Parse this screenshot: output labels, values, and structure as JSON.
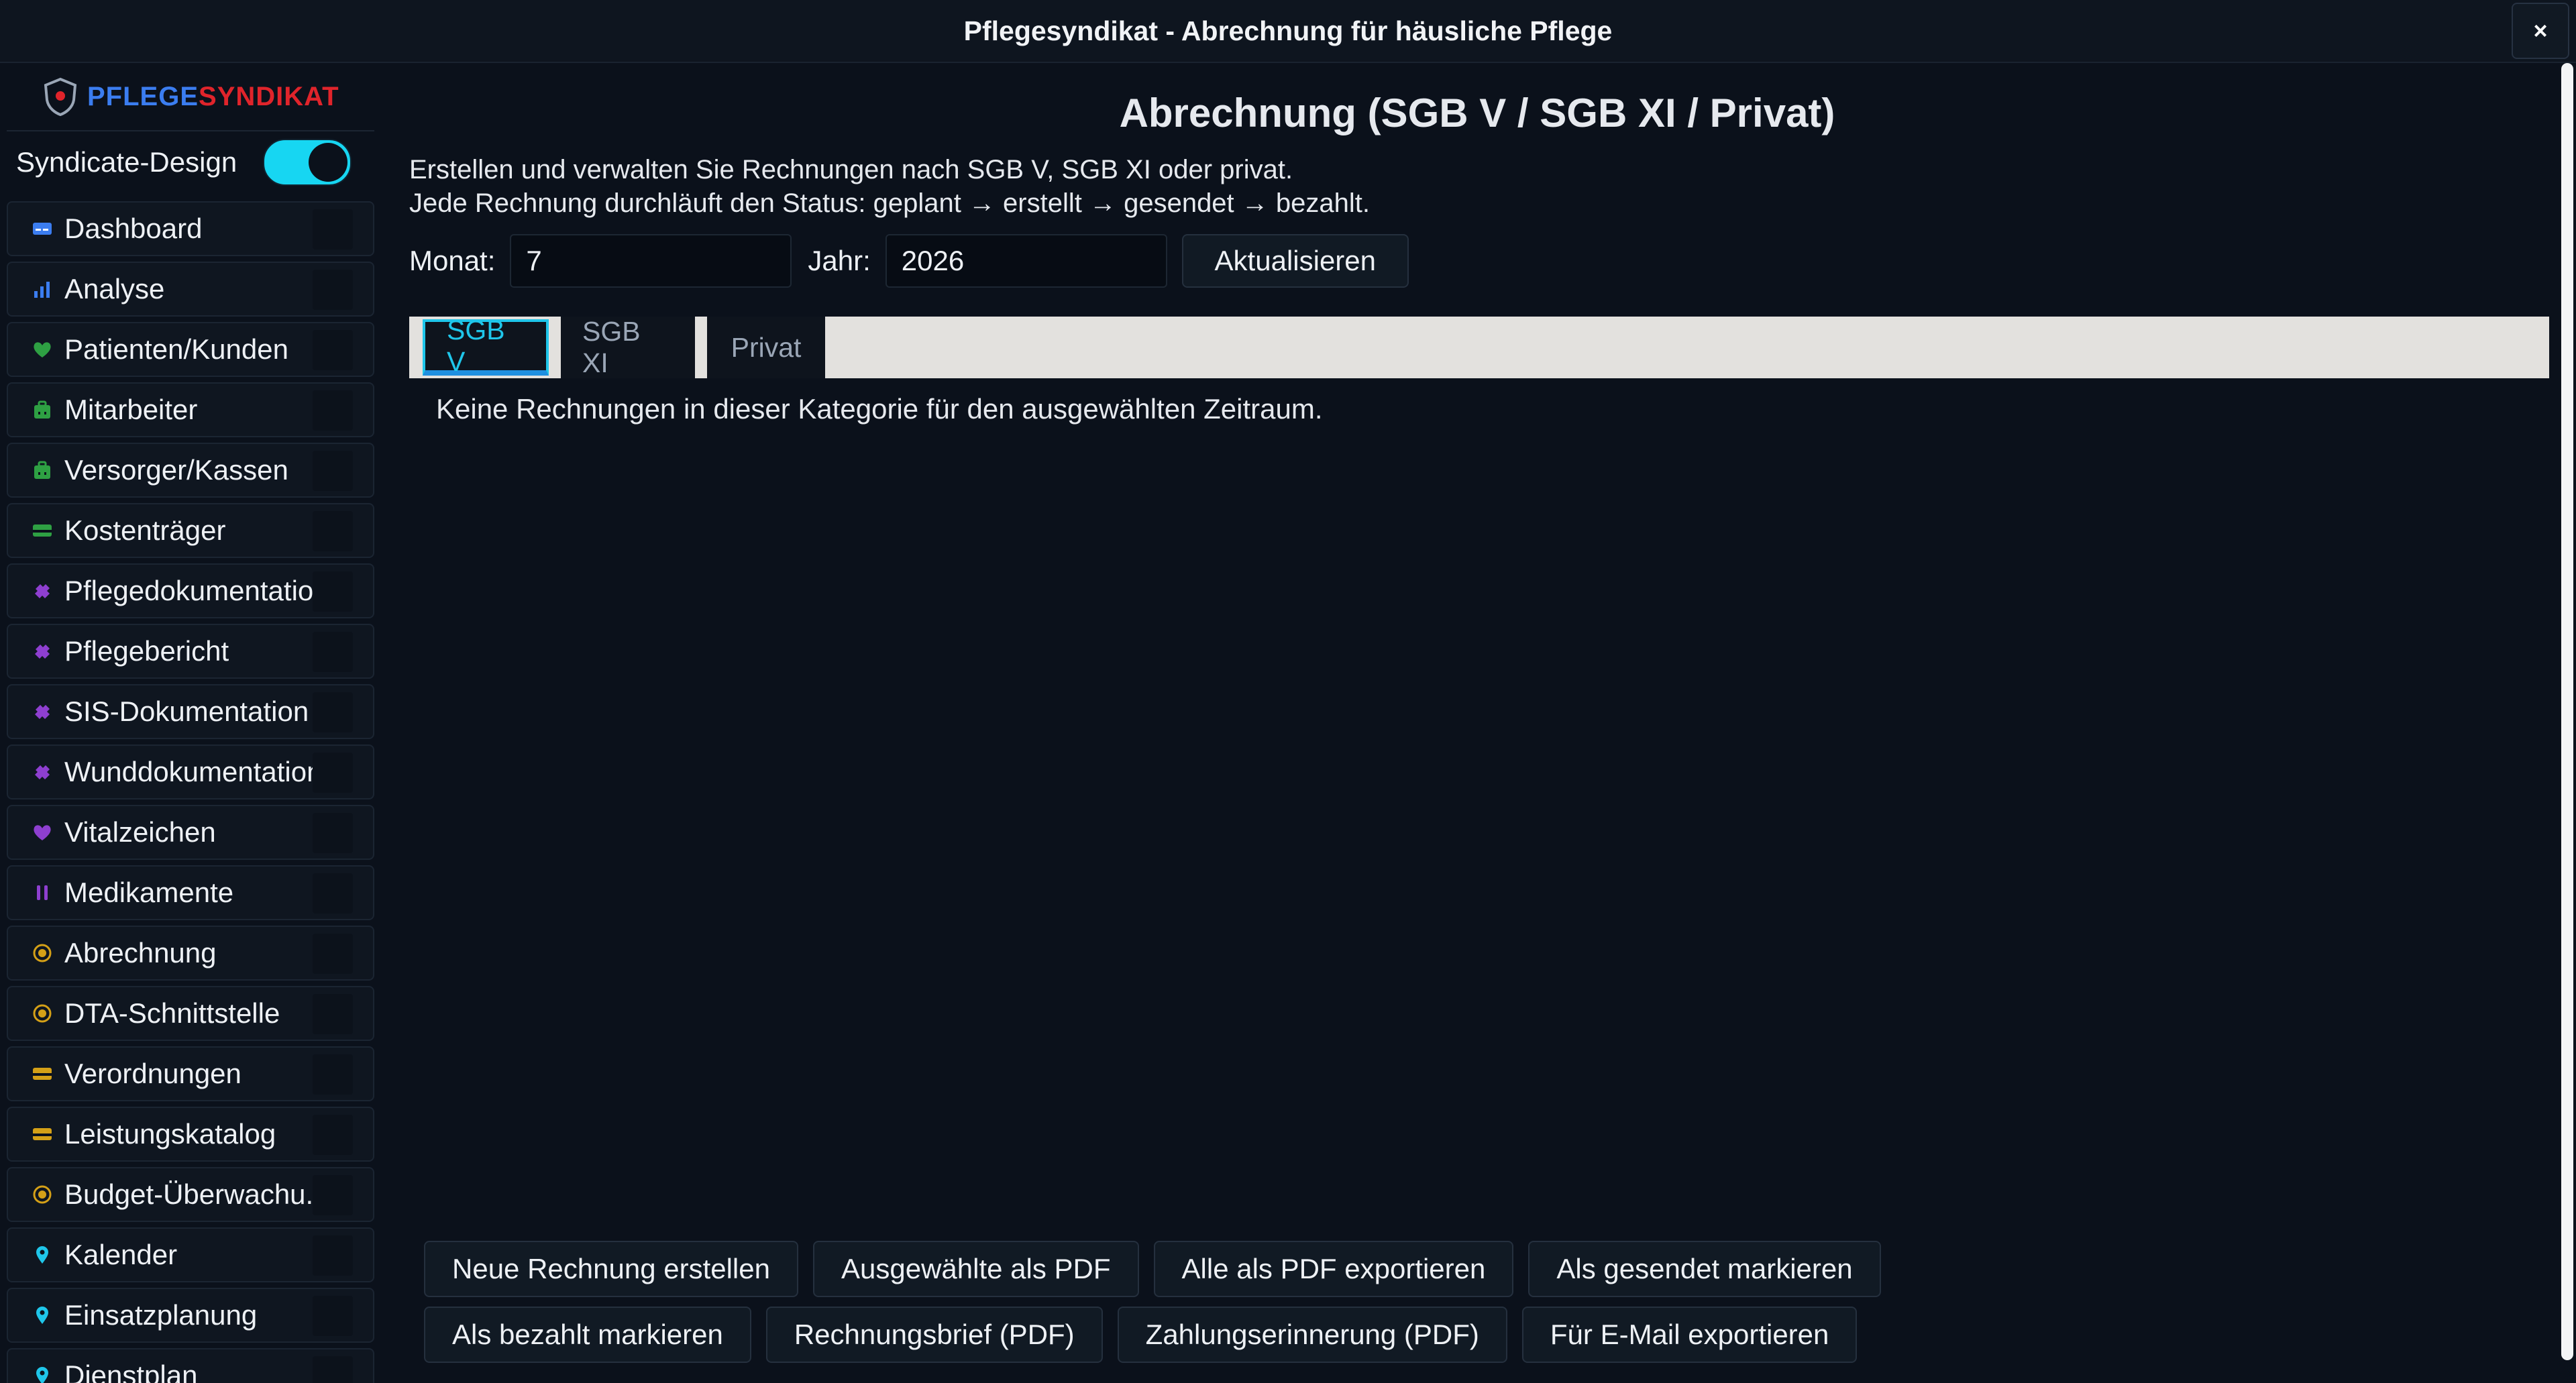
{
  "window": {
    "title": "Pflegesyndikat - Abrechnung für häusliche Pflege",
    "close_label": "×"
  },
  "sidebar": {
    "logo_part1": "PFLEGE",
    "logo_part2": "SYNDIKAT",
    "design_toggle_label": "Syndicate-Design",
    "design_toggle_on": true,
    "items": [
      {
        "label": "Dashboard",
        "icon": "dashboard-card-icon",
        "color": "#3b7df0"
      },
      {
        "label": "Analyse",
        "icon": "bar-chart-icon",
        "color": "#3b7df0"
      },
      {
        "label": "Patienten/Kunden",
        "icon": "heart-icon",
        "color": "#2ea043"
      },
      {
        "label": "Mitarbeiter",
        "icon": "briefcase-icon",
        "color": "#2ea043"
      },
      {
        "label": "Versorger/Kassen",
        "icon": "briefcase-icon",
        "color": "#2ea043"
      },
      {
        "label": "Kostenträger",
        "icon": "card-icon",
        "color": "#2ea043"
      },
      {
        "label": "Pflegedokumentation",
        "icon": "puzzle-icon",
        "color": "#8e3fd0"
      },
      {
        "label": "Pflegebericht",
        "icon": "puzzle-icon",
        "color": "#8e3fd0"
      },
      {
        "label": "SIS-Dokumentation",
        "icon": "puzzle-icon",
        "color": "#8e3fd0"
      },
      {
        "label": "Wunddokumentation",
        "icon": "puzzle-icon",
        "color": "#8e3fd0"
      },
      {
        "label": "Vitalzeichen",
        "icon": "heart-icon",
        "color": "#8e3fd0"
      },
      {
        "label": "Medikamente",
        "icon": "pause-icon",
        "color": "#8e3fd0"
      },
      {
        "label": "Abrechnung",
        "icon": "coin-icon",
        "color": "#d4a017"
      },
      {
        "label": "DTA-Schnittstelle",
        "icon": "coin-icon",
        "color": "#d4a017"
      },
      {
        "label": "Verordnungen",
        "icon": "card-icon",
        "color": "#d4a017"
      },
      {
        "label": "Leistungskatalog",
        "icon": "card-icon",
        "color": "#d4a017"
      },
      {
        "label": "Budget-Überwachu...",
        "icon": "coin-icon",
        "color": "#d4a017"
      },
      {
        "label": "Kalender",
        "icon": "pin-icon",
        "color": "#1fc6ea"
      },
      {
        "label": "Einsatzplanung",
        "icon": "pin-icon",
        "color": "#1fc6ea"
      },
      {
        "label": "Dienstplan",
        "icon": "pin-icon",
        "color": "#1fc6ea"
      }
    ]
  },
  "main": {
    "title": "Abrechnung (SGB V / SGB XI / Privat)",
    "intro_line1": "Erstellen und verwalten Sie Rechnungen nach SGB V, SGB XI oder privat.",
    "intro_line2": "Jede Rechnung durchläuft den Status: geplant → erstellt → gesendet → bezahlt.",
    "month_label": "Monat:",
    "month_value": "7",
    "year_label": "Jahr:",
    "year_value": "2026",
    "refresh_label": "Aktualisieren",
    "tabs": [
      {
        "label": "SGB V",
        "active": true
      },
      {
        "label": "SGB XI",
        "active": false
      },
      {
        "label": "Privat",
        "active": false
      }
    ],
    "empty_message": "Keine Rechnungen in dieser Kategorie für den ausgewählten Zeitraum.",
    "actions_row1": [
      "Neue Rechnung erstellen",
      "Ausgewählte als PDF",
      "Alle als PDF exportieren",
      "Als gesendet markieren"
    ],
    "actions_row2": [
      "Als bezahlt markieren",
      "Rechnungsbrief (PDF)",
      "Zahlungserinnerung (PDF)",
      "Für E-Mail exportieren"
    ]
  },
  "colors": {
    "accent": "#1fc6ea",
    "brand_blue": "#3b7df0",
    "brand_red": "#e0242b",
    "background": "#0b111b"
  }
}
